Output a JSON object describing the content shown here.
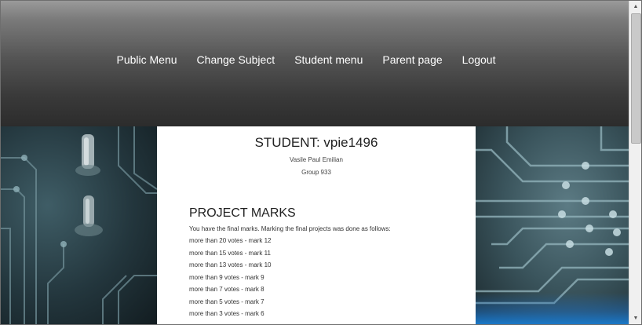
{
  "nav": {
    "items": [
      "Public Menu",
      "Change Subject",
      "Student menu",
      "Parent page",
      "Logout"
    ]
  },
  "student": {
    "title": "STUDENT: vpie1496",
    "name": "Vasile Paul Emilian",
    "group": "Group 933"
  },
  "marks": {
    "title": "PROJECT MARKS",
    "intro": "You have the final marks. Marking the final projects was done as follows:",
    "rules": [
      "more than 20 votes - mark 12",
      "more than 15 votes - mark 11",
      "more than 13 votes - mark 10",
      "more than 9 votes - mark 9",
      "more than 7 votes - mark 8",
      "more than 5 votes - mark 7",
      "more than 3 votes - mark 6"
    ]
  },
  "scrollbar": {
    "up_icon": "scroll-up-arrow-icon",
    "down_icon": "scroll-down-arrow-icon"
  }
}
